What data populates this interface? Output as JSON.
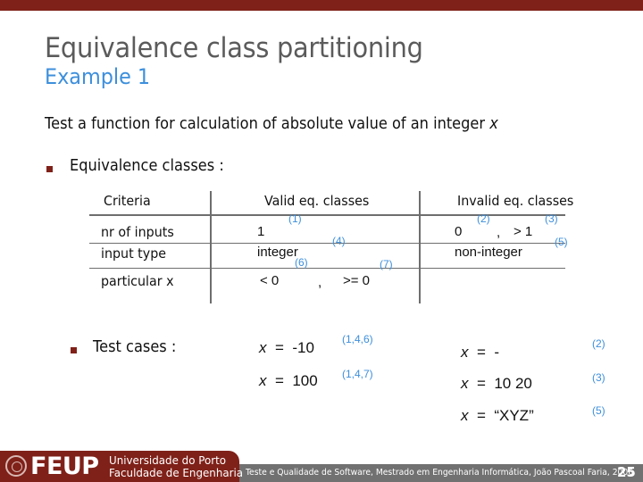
{
  "slide": {
    "title": "Equivalence class partitioning",
    "subtitle": "Example 1",
    "intro_text": "Test a function for calculation of absolute value of an integer ",
    "intro_var": "x",
    "bullets": {
      "equivalence_classes": "Equivalence classes :",
      "test_cases": "Test cases :"
    }
  },
  "table": {
    "headers": [
      "Criteria",
      "Valid eq. classes",
      "Invalid eq. classes"
    ],
    "rows": [
      {
        "criteria": "nr of inputs",
        "valid": [
          {
            "value": "1",
            "ref": "(1)"
          }
        ],
        "invalid": [
          {
            "value": "0",
            "ref": "(2)"
          },
          {
            "sep": ","
          },
          {
            "value": "> 1",
            "ref": "(3)"
          }
        ]
      },
      {
        "criteria": "input type",
        "valid": [
          {
            "value": "integer",
            "ref": "(4)"
          }
        ],
        "invalid": [
          {
            "value": "non-integer",
            "ref": "(5)"
          }
        ]
      },
      {
        "criteria": "particular x",
        "valid": [
          {
            "value": "< 0",
            "ref": "(6)"
          },
          {
            "sep": ","
          },
          {
            "value": ">= 0",
            "ref": "(7)"
          }
        ],
        "invalid": []
      }
    ],
    "separator": ","
  },
  "test_cases": {
    "valid": [
      {
        "var": "x",
        "op": "=",
        "value": "-10",
        "ref": "(1,4,6)"
      },
      {
        "var": "x",
        "op": "=",
        "value": "100",
        "ref": "(1,4,7)"
      }
    ],
    "invalid": [
      {
        "var": "x",
        "op": "=",
        "value": "-",
        "ref": "(2)"
      },
      {
        "var": "x",
        "op": "=",
        "value": "10 20",
        "ref": "(3)"
      },
      {
        "var": "x",
        "op": "=",
        "value": "“XYZ”",
        "ref": "(5)"
      }
    ]
  },
  "footer": {
    "logo_text": "FEUP",
    "university_line1": "Universidade do Porto",
    "university_line2": "Faculdade de Engenharia",
    "caption": "Teste e Qualidade de Software, Mestrado em Engenharia Informática, João Pascoal Faria, 2006",
    "page_number": "25"
  },
  "colors": {
    "brand_red": "#7f2119",
    "accent_blue": "#3d8fdc",
    "footer_gray": "#717171",
    "title_gray": "#5b5b5b"
  }
}
